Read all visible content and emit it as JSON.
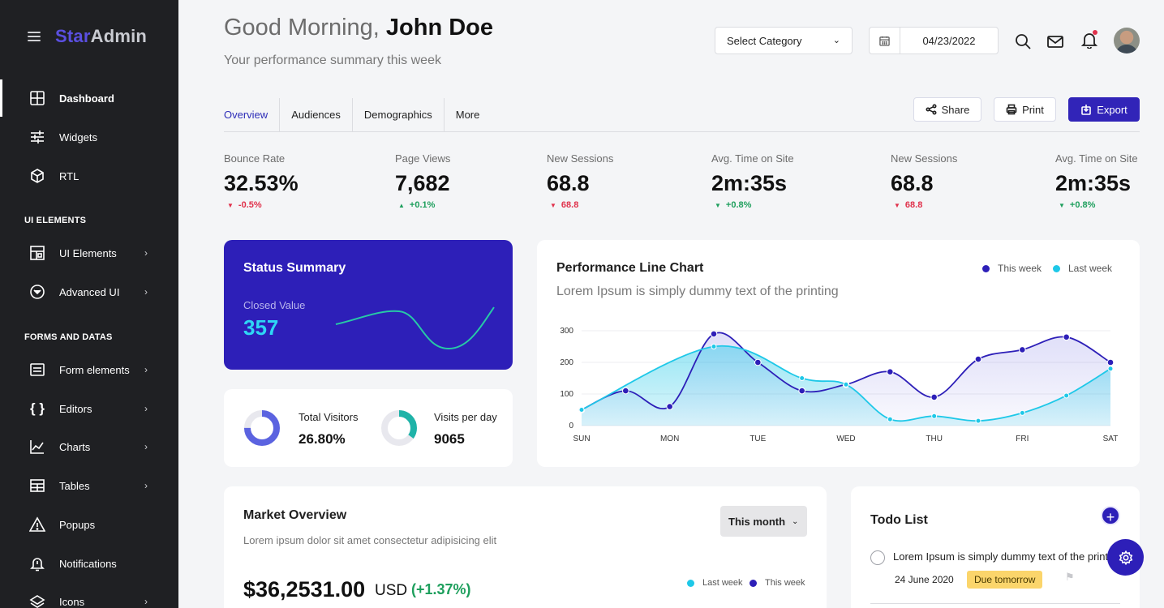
{
  "brand": {
    "name_part1": "Star",
    "name_part2": "Admin"
  },
  "sidebar": {
    "items": [
      {
        "label": "Dashboard",
        "icon": "grid-icon",
        "chevron": ""
      },
      {
        "label": "Widgets",
        "icon": "sliders-icon",
        "chevron": ""
      },
      {
        "label": "RTL",
        "icon": "cube-icon",
        "chevron": ""
      }
    ],
    "section_ui": "UI ELEMENTS",
    "ui_items": [
      {
        "label": "UI Elements",
        "icon": "layout-icon",
        "chevron": "›"
      },
      {
        "label": "Advanced UI",
        "icon": "circle-chevron-icon",
        "chevron": "›"
      }
    ],
    "section_forms": "FORMS AND DATAS",
    "form_items": [
      {
        "label": "Form elements",
        "icon": "form-icon",
        "chevron": "›"
      },
      {
        "label": "Editors",
        "icon": "braces-icon",
        "chevron": "›"
      },
      {
        "label": "Charts",
        "icon": "chart-icon",
        "chevron": "›"
      },
      {
        "label": "Tables",
        "icon": "table-icon",
        "chevron": "›"
      },
      {
        "label": "Popups",
        "icon": "warning-icon",
        "chevron": ""
      },
      {
        "label": "Notifications",
        "icon": "bell-alert-icon",
        "chevron": ""
      },
      {
        "label": "Icons",
        "icon": "layers-icon",
        "chevron": "›"
      }
    ]
  },
  "header": {
    "greeting": "Good Morning,",
    "user_name": "John Doe",
    "subtitle": "Your performance summary this week",
    "category_select": "Select Category",
    "date": "04/23/2022"
  },
  "tabs": [
    "Overview",
    "Audiences",
    "Demographics",
    "More"
  ],
  "actions": {
    "share": "Share",
    "print": "Print",
    "export": "Export"
  },
  "stats": [
    {
      "label": "Bounce Rate",
      "value": "32.53%",
      "change": "-0.5%",
      "dir": "down"
    },
    {
      "label": "Page Views",
      "value": "7,682",
      "change": "+0.1%",
      "dir": "up"
    },
    {
      "label": "New Sessions",
      "value": "68.8",
      "change": "68.8",
      "dir": "down"
    },
    {
      "label": "Avg. Time on Site",
      "value": "2m:35s",
      "change": "+0.8%",
      "dir": "up"
    },
    {
      "label": "New Sessions",
      "value": "68.8",
      "change": "68.8",
      "dir": "down"
    },
    {
      "label": "Avg. Time on Site",
      "value": "2m:35s",
      "change": "+0.8%",
      "dir": "up"
    }
  ],
  "status_summary": {
    "title": "Status Summary",
    "label": "Closed Value",
    "value": "357"
  },
  "visitors": {
    "total_label": "Total Visitors",
    "total_value": "26.80%",
    "total_fraction": 0.75,
    "perday_label": "Visits per day",
    "perday_value": "9065",
    "perday_fraction": 0.35
  },
  "performance": {
    "title": "Performance Line Chart",
    "subtitle": "Lorem Ipsum is simply dummy text of the printing",
    "legend_this": "This week",
    "legend_last": "Last week"
  },
  "chart_data": {
    "type": "line",
    "x": [
      "SUN",
      "MON",
      "TUE",
      "WED",
      "THU",
      "FRI",
      "SAT"
    ],
    "ylim": [
      0,
      300
    ],
    "yticks": [
      0,
      100,
      200,
      300
    ],
    "grid": true,
    "legend": "top-right",
    "series": [
      {
        "name": "This week",
        "color": "#2d1fb8",
        "x": [
          0,
          0.5,
          1,
          1.5,
          2,
          2.5,
          3,
          3.5,
          4,
          4.5,
          5,
          5.5,
          6
        ],
        "values": [
          50,
          110,
          60,
          290,
          200,
          110,
          130,
          170,
          90,
          210,
          240,
          280,
          200
        ]
      },
      {
        "name": "Last week",
        "color": "#1ec8e8",
        "x": [
          0,
          1.5,
          2.5,
          3,
          3.5,
          4,
          4.5,
          5,
          5.5,
          6
        ],
        "values": [
          50,
          250,
          150,
          130,
          20,
          30,
          15,
          40,
          95,
          180
        ]
      }
    ]
  },
  "market": {
    "title": "Market Overview",
    "subtitle": "Lorem ipsum dolor sit amet consectetur adipisicing elit",
    "period": "This month",
    "amount": "$36,2531.00",
    "currency": "USD",
    "change": "(+1.37%)",
    "legend_last": "Last week",
    "legend_this": "This week"
  },
  "todo": {
    "title": "Todo List",
    "item_text": "Lorem Ipsum is simply dummy text of the printing",
    "item_date": "24 June 2020",
    "item_badge": "Due tomorrow"
  },
  "colors": {
    "accent": "#2d1fb8",
    "cyan": "#1ec8e8",
    "sidebar": "#1f2023",
    "up": "#1e9f5d",
    "down": "#e0314b"
  }
}
